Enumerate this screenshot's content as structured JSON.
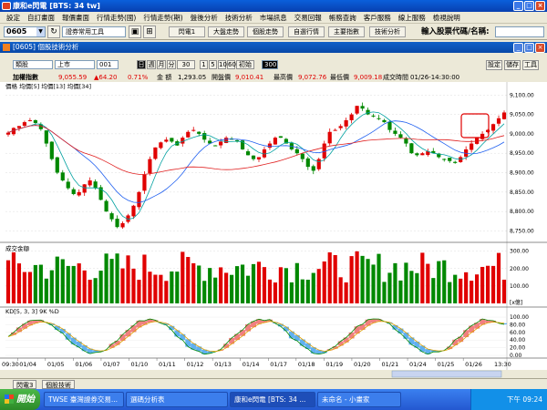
{
  "app": {
    "title": "康和e閃電 [BTS: 34 tw]"
  },
  "menu": [
    "設定",
    "自訂畫面",
    "報價畫面",
    "行情走勢(國)",
    "行情走勢(期)",
    "盤後分析",
    "技術分析",
    "市場訊息",
    "交易回報",
    "帳務查詢",
    "客戶服務",
    "線上服務",
    "檢視說明"
  ],
  "toolbar": {
    "stock_code": "0605",
    "tool_select": "證券常用工具",
    "buttons": [
      "閃電1",
      "大盤走勢",
      "個股走勢",
      "自選行情",
      "主要指數",
      "技術分析"
    ],
    "stock_prompt": "輸入股票代碼/名稱:"
  },
  "chart_window": {
    "title": "[0605] 個股技術分析",
    "type_select": "類股",
    "market_select": "上市",
    "code_select": "001",
    "periods": [
      "日",
      "週",
      "月",
      "分",
      "30"
    ],
    "mins": [
      "1",
      "5",
      "10",
      "60",
      "初始"
    ],
    "count": "300",
    "right_buttons": [
      "設定",
      "儲存",
      "工具"
    ]
  },
  "info": {
    "name": "加權指數",
    "price": "9,055.59",
    "change": "▲64.20",
    "pct": "0.71%",
    "vol_label": "金 額",
    "vol": "1,293.05",
    "open_label": "開盤價",
    "open": "9,010.41",
    "high_label": "最高價",
    "high": "9,072.76",
    "low_label": "最低價",
    "low": "9,009.18",
    "time_label": "成交時間",
    "time": "01/26-14:30:00"
  },
  "main_legend": "價格 均價[5] 均價[13] 均價[34]",
  "volume_legend": "成交金額",
  "kd_legend": "KD[5, 3, 3] 9K %D",
  "x_labels": [
    "09:30",
    "01/04",
    "01/05",
    "01/06",
    "01/07",
    "01/10",
    "01/11",
    "01/12",
    "01/13",
    "01/14",
    "01/17",
    "01/18",
    "01/19",
    "01/20",
    "01/21",
    "01/24",
    "01/25",
    "01/26",
    "13:30"
  ],
  "bottom_tabs": [
    "閃電3",
    "個股技術"
  ],
  "taskbar": {
    "start": "開始",
    "tasks": [
      "TWSE 臺灣證券交易...",
      "選碼分析表",
      "康和e閃電 [BTS: 34 ...",
      "未命名 - 小畫家"
    ],
    "clock": "下午 09:24"
  },
  "chart_data": [
    {
      "type": "candlestick",
      "title": "加權指數",
      "y_ticks": [
        "9,100.00",
        "9,050.00",
        "9,000.00",
        "8,950.00",
        "8,900.00",
        "8,850.00",
        "8,800.00",
        "8,750.00"
      ],
      "ylim": [
        8730,
        9110
      ],
      "series": [
        {
          "name": "價格",
          "values": [
            9003,
            9015,
            9020,
            9030,
            9035,
            9028,
            9012,
            8975,
            8935,
            8900,
            8880,
            8860,
            8845,
            8850,
            8870,
            8880,
            8860,
            8830,
            8800,
            8780,
            8760,
            8770,
            8790,
            8815,
            8850,
            8895,
            8935,
            8965,
            8978,
            8985,
            8980,
            8970,
            8990,
            9005,
            9010,
            9000,
            8985,
            8975,
            8970,
            8980,
            8990,
            8985,
            8980,
            8960,
            8945,
            8935,
            8940,
            8960,
            8975,
            8990,
            8990,
            8975,
            8960,
            8950,
            8935,
            8915,
            8905,
            8935,
            8975,
            9005,
            9010,
            9020,
            9035,
            9050,
            9072,
            9065,
            9050,
            9045,
            9040,
            9030,
            9010,
            9000,
            8990,
            8975,
            8950,
            8945,
            8950,
            8955,
            8950,
            8940,
            8935,
            8930,
            8925,
            8940,
            8960,
            8975,
            8990,
            9000,
            9010,
            9025,
            9040,
            9055
          ]
        },
        {
          "name": "均價[5]",
          "values": []
        },
        {
          "name": "均價[13]",
          "values": []
        },
        {
          "name": "均價[34]",
          "values": []
        }
      ]
    },
    {
      "type": "bar",
      "title": "成交金額",
      "y_ticks": [
        "300.00",
        "200.00",
        "100.00"
      ],
      "unit": "[x億]",
      "ylim": [
        0,
        340
      ]
    },
    {
      "type": "line",
      "title": "KD[5, 3, 3]",
      "y_ticks": [
        "100.00",
        "80.00",
        "60.00",
        "40.00",
        "20.00",
        "0.00"
      ],
      "ylim": [
        0,
        100
      ]
    }
  ]
}
